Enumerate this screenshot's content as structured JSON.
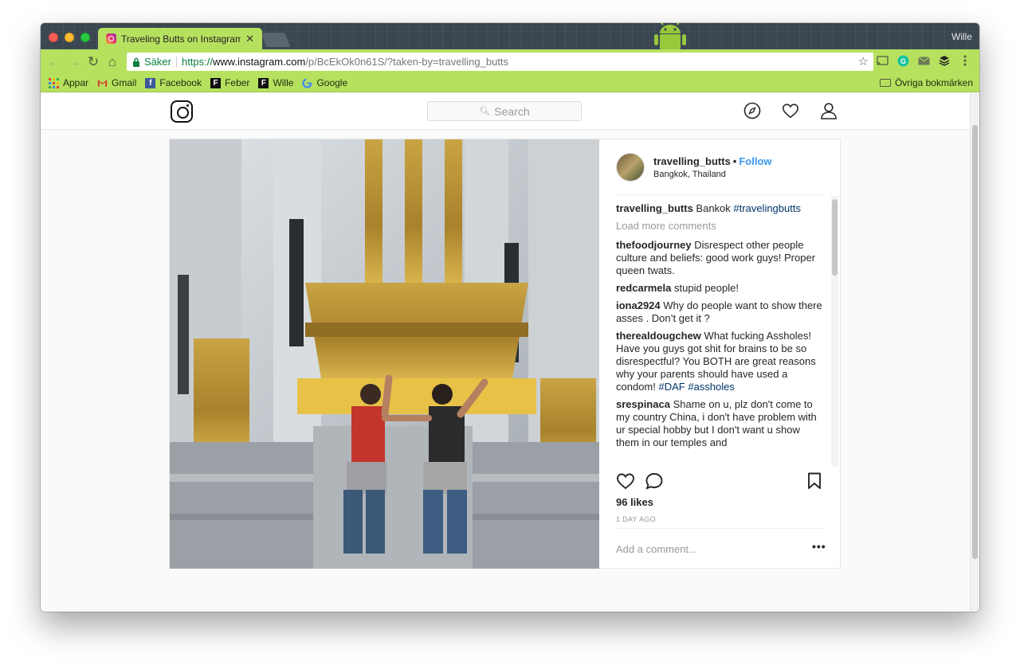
{
  "browser": {
    "tab_title": "Traveling Butts on Instagram",
    "tab_close": "✕",
    "profile_name": "Wille",
    "secure_label": "Säker",
    "url_scheme": "https://",
    "url_host": "www.instagram.com",
    "url_rest": "/p/BcEkOk0n61S/?taken-by=travelling_butts",
    "bookmarks": [
      {
        "label": "Appar"
      },
      {
        "label": "Gmail"
      },
      {
        "label": "Facebook"
      },
      {
        "label": "Feber"
      },
      {
        "label": "Wille"
      },
      {
        "label": "Google"
      }
    ],
    "other_bookmarks": "Övriga bokmärken"
  },
  "instagram": {
    "search_placeholder": "Search",
    "post": {
      "username": "travelling_butts",
      "follow_label": "Follow",
      "location": "Bangkok, Thailand",
      "caption_user": "travelling_butts",
      "caption_text": "Bankok",
      "caption_tag": "#travelingbutts",
      "load_more": "Load more comments",
      "comments": [
        {
          "user": "thefoodjourney",
          "text": "Disrespect other people culture and beliefs: good work guys! Proper queen twats.",
          "tags": ""
        },
        {
          "user": "redcarmela",
          "text": "stupid people!",
          "tags": ""
        },
        {
          "user": "iona2924",
          "text": "Why do people want to show there asses . Don’t get it ?",
          "tags": ""
        },
        {
          "user": "therealdougchew",
          "text": "What fucking Assholes! Have you guys got shit for brains to be so disrespectful? You BOTH are great reasons why your parents should have used a condom!",
          "tags": "#DAF #assholes"
        },
        {
          "user": "srespinaca",
          "text": "Shame on u, plz don't come to my country China, i don't have problem with ur special hobby but I don't want u show them in our temples and",
          "tags": ""
        }
      ],
      "likes": "96 likes",
      "time": "1 DAY AGO",
      "add_comment_placeholder": "Add a comment...",
      "more_options": "•••"
    }
  },
  "colors": {
    "chrome_theme": "#b6e15f",
    "titlebar": "#3a4650",
    "link_blue": "#3897f0",
    "hashtag": "#003569"
  },
  "icons": {
    "explore": "compass-icon",
    "activity": "heart-icon",
    "profile": "person-icon",
    "like": "heart-outline-icon",
    "comment": "speech-bubble-icon",
    "save": "bookmark-icon"
  }
}
